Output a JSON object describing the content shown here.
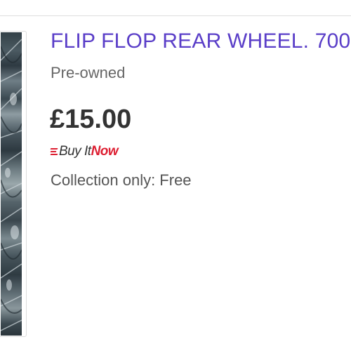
{
  "listing": {
    "title": "FLIP FLOP REAR WHEEL. 700",
    "condition": "Pre-owned",
    "price": "£15.00",
    "buy_it_now": {
      "buy_text": "Buy It",
      "now_text": "Now",
      "logo_icon": "buy-it-now-lines-icon"
    },
    "shipping": "Collection only: Free"
  },
  "colors": {
    "title_link": "#5a3ec8",
    "price": "#333333",
    "buy_it_now_accent": "#dd1e31",
    "secondary_text": "#666666"
  }
}
